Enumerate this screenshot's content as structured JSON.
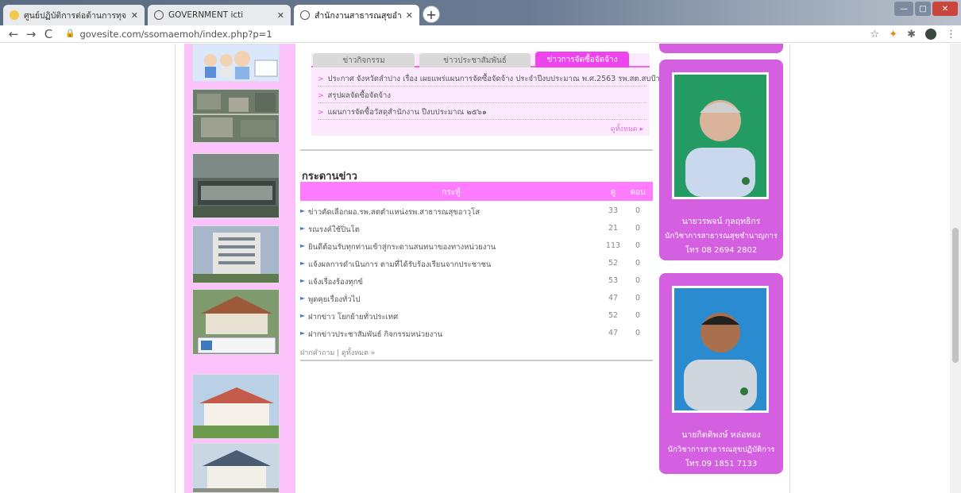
{
  "browser": {
    "tabs": [
      {
        "title": "ศูนย์ปฏิบัติการต่อต้านการทุจริต กระทร",
        "active": false,
        "icon": "site-icon"
      },
      {
        "title": "GOVERNMENT icti",
        "active": false,
        "icon": "globe-icon"
      },
      {
        "title": "สำนักงานสาธารณสุขอำเภอแม่เมาะ wi",
        "active": true,
        "icon": "globe-icon"
      }
    ],
    "url": "govesite.com/ssomaemoh/index.php?p=1",
    "nav": {
      "back": "←",
      "forward": "→",
      "reload": "C"
    },
    "toolbar_icons": [
      "star-icon",
      "extension-icon",
      "puzzle-icon",
      "profile-icon",
      "menu-icon"
    ]
  },
  "news_tabs": {
    "tabs": [
      "ข่าวกิจกรรม",
      "ข่าวประชาสัมพันธ์",
      "ข่าวการจัดซื้อจัดจ้าง"
    ],
    "selected": 2,
    "items": [
      "ประกาศ จังหวัดลำปาง เรื่อง เผยแพร่แผนการจัดซื้อจัดจ้าง ประจำปีงบประมาณ พ.ศ.2563 รพ.สต.สบป้าด",
      "สรุปผลจัดซื้อจัดจ้าง",
      "แผนการจัดซื้อวัสดุสำนักงาน ปีงบประมาณ ๒๕๖๑"
    ],
    "more_label": "ดูทั้งหมด ▸"
  },
  "webboard": {
    "title": "กระดานข่าว",
    "columns": {
      "topic": "กระทู้",
      "views": "ดู",
      "replies": "ตอบ"
    },
    "rows": [
      {
        "topic": "ข่าวคัดเลือกผอ.รพ.สตตำแหน่งรพ.สาธารณสุขอาวุโส",
        "views": "33",
        "replies": "0"
      },
      {
        "topic": "รณรงค์ใช้ปิ่นโต",
        "views": "21",
        "replies": "0"
      },
      {
        "topic": "ยินดีต้อนรับทุกท่านเข้าสู่กระดานสนทนาของทางหน่วยงาน",
        "views": "113",
        "replies": "0"
      },
      {
        "topic": "แจ้งผลการดำเนินการ ตามที่ได้รับร้องเรียนจากประชาชน",
        "views": "52",
        "replies": "0"
      },
      {
        "topic": "แจ้งเรื่องร้องทุกข์",
        "views": "53",
        "replies": "0"
      },
      {
        "topic": "พูดคุยเรื่องทั่วไป",
        "views": "47",
        "replies": "0"
      },
      {
        "topic": "ฝากข่าว โยกย้ายทั่วประเทศ",
        "views": "52",
        "replies": "0"
      },
      {
        "topic": "ฝากข่าวประชาสัมพันธ์ กิจกรรมหน่วยงาน",
        "views": "47",
        "replies": "0"
      }
    ],
    "footer": "ฝากคำถาม | ดูทั้งหมด »"
  },
  "profiles": [
    {
      "name": "นายวรพจน์ กุลฤทธิกร",
      "role": "นักวิชาการสาธารณสุขชำนาญการ",
      "tel": "โทร 08 2694 2802"
    },
    {
      "name": "นายกิตติพงษ์ หล่อทอง",
      "role": "นักวิชาการสาธารณสุขปฏิบัติการ",
      "tel": "โทร.09 1851 7133"
    }
  ],
  "sidebar_photos": [
    "cartoon-banner-image",
    "aerial-city-image",
    "ministry-sign-image",
    "office-building-image",
    "health-office-image",
    "health-center-image",
    "small-building-image"
  ],
  "colors": {
    "accent": "#ee44ee",
    "sidebar": "#fbc2fb",
    "card": "#d45fe0"
  }
}
